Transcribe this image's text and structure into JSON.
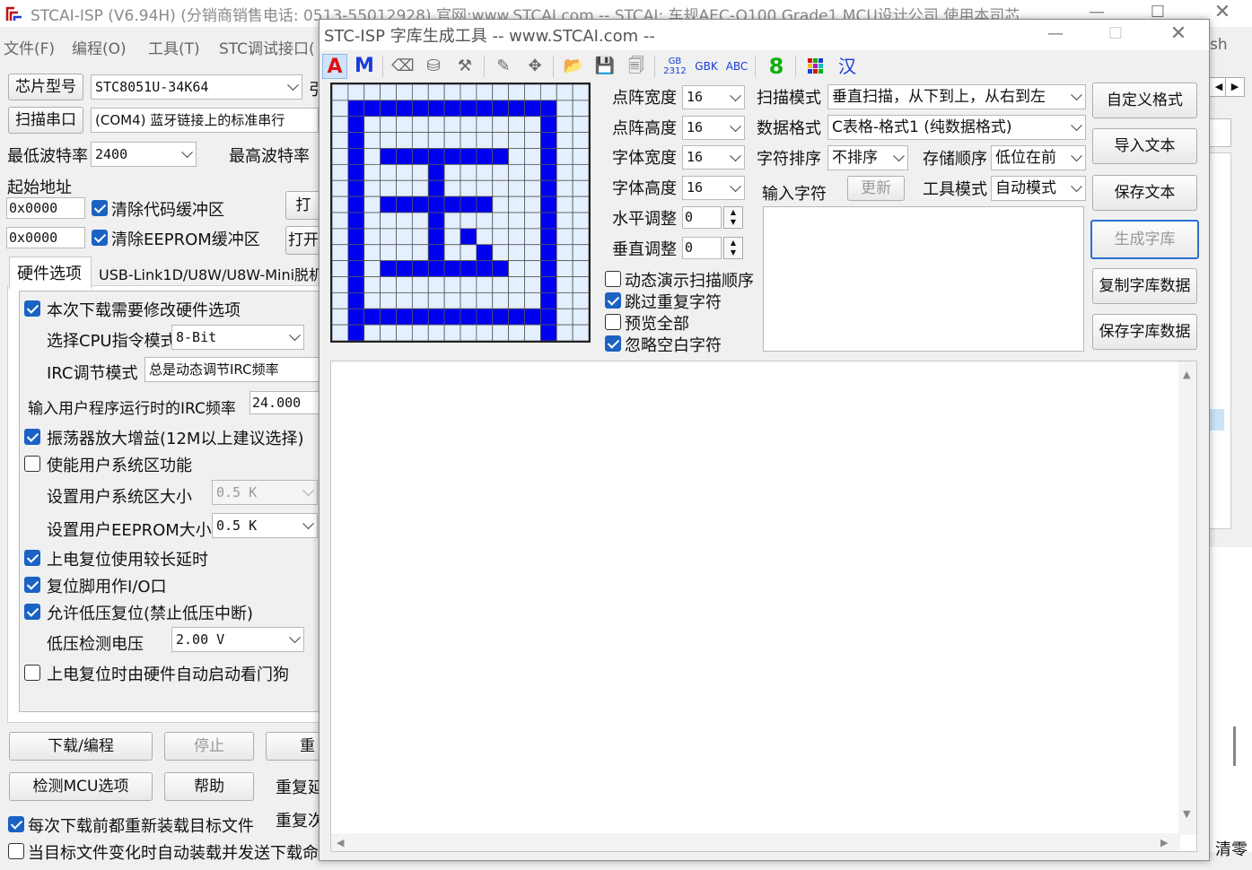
{
  "main_window": {
    "title": "STCAI-ISP (V6.94H) (分销商销售电话: 0513-55012928) 官网:www.STCAI.com  -- STCAI: 车规AEC-Q100 Grade1 MCU设计公司 使用本司芯...",
    "menu": [
      "文件(F)",
      "编程(O)",
      "工具(T)",
      "STC调试接口("
    ],
    "menu_right_fragment": "sh",
    "chip_model_button": "芯片型号",
    "chip_model_value": "STC8051U-34K64",
    "chip_model_trailing": "引",
    "scan_port_button": "扫描串口",
    "port_value": "(COM4) 蓝牙链接上的标准串行",
    "min_baud_label": "最低波特率",
    "min_baud_value": "2400",
    "max_baud_label": "最高波特率",
    "start_addr_label": "起始地址",
    "addr1": "0x0000",
    "clear_code_label": "清除代码缓冲区",
    "open1": "打",
    "addr2": "0x0000",
    "clear_eeprom_label": "清除EEPROM缓冲区",
    "open2": "打开",
    "tab_hw": "硬件选项",
    "tab_usb": "USB-Link1D/U8W/U8W-Mini脱机",
    "hw_options": {
      "modify_hw": "本次下载需要修改硬件选项",
      "cpu_mode_label": "选择CPU指令模式",
      "cpu_mode_value": "8-Bit",
      "irc_mode_label": "IRC调节模式",
      "irc_mode_value": "总是动态调节IRC频率",
      "irc_freq_label": "输入用户程序运行时的IRC频率",
      "irc_freq_value": "24.000",
      "osc_gain": "振荡器放大增益(12M以上建议选择)",
      "user_sys_area": "使能用户系统区功能",
      "user_sys_size_label": "设置用户系统区大小",
      "user_sys_size_value": "0.5 K",
      "user_eeprom_label": "设置用户EEPROM大小",
      "user_eeprom_value": "0.5 K",
      "long_delay": "上电复位使用较长延时",
      "reset_pin_io": "复位脚用作I/O口",
      "low_volt_reset": "允许低压复位(禁止低压中断)",
      "low_volt_label": "低压检测电压",
      "low_volt_value": "2.00 V",
      "watchdog": "上电复位时由硬件自动启动看门狗"
    },
    "download_button": "下载/编程",
    "stop_button": "停止",
    "re_button": "重",
    "detect_button": "检测MCU选项",
    "help_button": "帮助",
    "repeat1": "重复延",
    "repeat2": "重复次",
    "reload_label": "每次下载前都重新装载目标文件",
    "auto_send_label": "当目标文件变化时自动装载并发送下载命",
    "clear_fragment": "清零"
  },
  "dialog": {
    "title": "STC-ISP 字库生成工具 -- www.STCAI.com --",
    "toolbar": {
      "a_label": "A",
      "m_label": "M",
      "gb_top": "GB",
      "gb_bottom": "2312",
      "gbk_label": "GBK",
      "abc_label": "ABC",
      "eight_label": "8",
      "han_label": "汉"
    },
    "dot_width_label": "点阵宽度",
    "dot_width_value": "16",
    "dot_height_label": "点阵高度",
    "dot_height_value": "16",
    "font_width_label": "字体宽度",
    "font_width_value": "16",
    "font_height_label": "字体高度",
    "font_height_value": "16",
    "h_adjust_label": "水平调整",
    "h_adjust_value": "0",
    "v_adjust_label": "垂直调整",
    "v_adjust_value": "0",
    "scan_mode_label": "扫描模式",
    "scan_mode_value": "垂直扫描，从下到上，从右到左",
    "data_format_label": "数据格式",
    "data_format_value": "C表格-格式1 (纯数据格式)",
    "char_sort_label": "字符排序",
    "char_sort_value": "不排序",
    "store_order_label": "存储顺序",
    "store_order_value": "低位在前",
    "input_char_label": "输入字符",
    "update_button": "更新",
    "tool_mode_label": "工具模式",
    "tool_mode_value": "自动模式",
    "custom_format_button": "自定义格式",
    "import_text_button": "导入文本",
    "save_text_button": "保存文本",
    "generate_button": "生成字库",
    "copy_data_button": "复制字库数据",
    "save_data_button": "保存字库数据",
    "checkboxes": {
      "animate": "动态演示扫描顺序",
      "skip_dup": "跳过重复字符",
      "preview_all": "预览全部",
      "ignore_blank": "忽略空白字符"
    },
    "grid": {
      "rows": [
        "0000000000000000",
        "0111111111111100",
        "0100000000000100",
        "0100000000000100",
        "0101111111100100",
        "0100001000000100",
        "0100001000000100",
        "0101111111000100",
        "0100001000000100",
        "0100001010000100",
        "0100001001000100",
        "0101111111100100",
        "0100000000000100",
        "0100000000000100",
        "0111111111111100",
        "0100000000000100"
      ],
      "on_color": "#0000f0",
      "off_color": "#e4f0ff",
      "line_color": "#555555"
    }
  },
  "colors": {
    "accent": "#1a62c4",
    "a_icon": "#e01010",
    "m_icon": "#1a3cd8",
    "eight_icon": "#10b010",
    "han_icon": "#1a3cd8"
  }
}
